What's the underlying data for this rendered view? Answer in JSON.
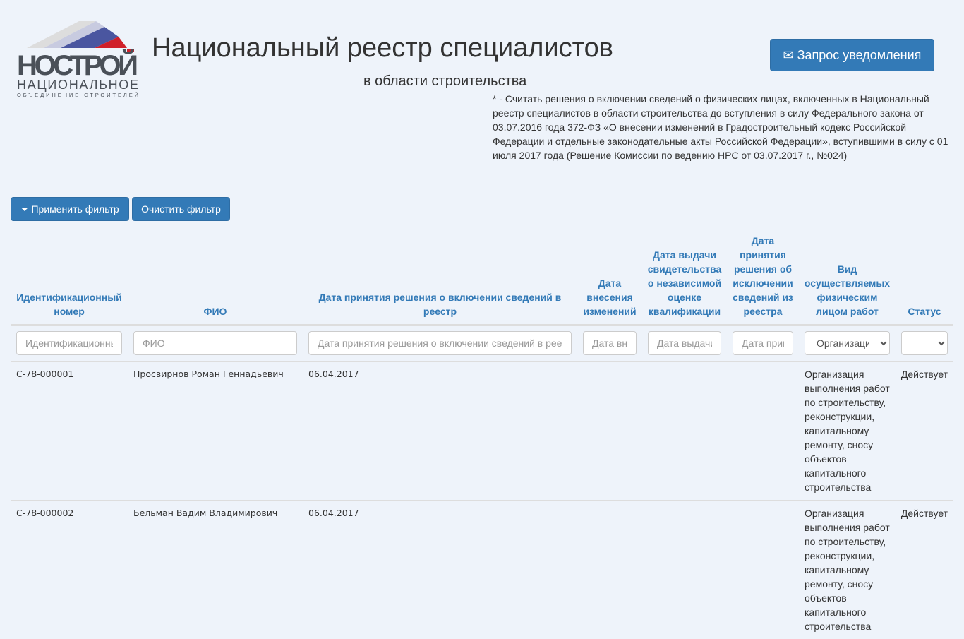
{
  "logo": {
    "brand": "НОСТРОЙ",
    "line2": "НАЦИОНАЛЬНОЕ",
    "line3": "ОБЪЕДИНЕНИЕ СТРОИТЕЛЕЙ"
  },
  "header": {
    "title": "Национальный реестр специалистов",
    "subtitle": "в области строительства",
    "note": "* - Считать решения о включении сведений о физических лицах, включенных в Национальный реестр специалистов в области строительства до вступления в силу Федерального закона от 03.07.2016 года 372-ФЗ «О внесении изменений в Градостроительный кодекс Российской Федерации и отдельные законодательные акты Российской Федерации», вступившими в силу с 01 июля 2017 года (Решение Комиссии по ведению НРС от 03.07.2017 г., №024)",
    "notify_label": "Запрос уведомления"
  },
  "filters": {
    "apply_label": "Применить фильтр",
    "clear_label": "Очистить фильтр"
  },
  "table": {
    "columns": [
      "Идентификационный номер",
      "ФИО",
      "Дата принятия решения о включении сведений в реестр",
      "Дата внесения изменений",
      "Дата выдачи свидетельства о независимой оценке квалификации",
      "Дата принятия решения об исключении сведений из реестра",
      "Вид осуществляемых физическим лицом работ",
      "Статус"
    ],
    "placeholders": [
      "Идентификационный номер",
      "ФИО",
      "Дата принятия решения о включении сведений в реестр",
      "Дата внесения изменений",
      "Дата выдачи свидетельства",
      "Дата принятия решения"
    ],
    "work_select": "Организация выполнения работ",
    "status_select": "",
    "rows": [
      {
        "id": "С-78-000001",
        "name": "Просвирнов Роман Геннадьевич",
        "date_in": "06.04.2017",
        "date_change": "",
        "date_cert": "",
        "date_out": "",
        "work": "Организация выполнения работ по строительству, реконструкции, капитальному ремонту, сносу объектов капитального строительства",
        "status": "Действует"
      },
      {
        "id": "С-78-000002",
        "name": "Бельман Вадим Владимирович",
        "date_in": "06.04.2017",
        "date_change": "",
        "date_cert": "",
        "date_out": "",
        "work": "Организация выполнения работ по строительству, реконструкции, капитальному ремонту, сносу объектов капитального строительства",
        "status": "Действует"
      }
    ]
  }
}
